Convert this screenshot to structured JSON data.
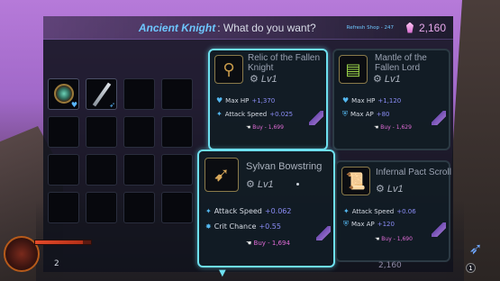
{
  "header": {
    "merchant": "Ancient Knight",
    "question": ": What do you want?",
    "refresh": "Refresh Shop - 247",
    "currency": "2,160"
  },
  "inventory": {
    "items": [
      "amulet-icon",
      "sword-icon"
    ],
    "empty_slots": 14
  },
  "shop": [
    {
      "name": "Relic of the Fallen Knight",
      "icon": "necklace-icon",
      "level": "Lv1",
      "stats": [
        {
          "label": "Max HP",
          "value": "+1,370"
        },
        {
          "label": "Attack Speed",
          "value": "+0.025"
        }
      ],
      "price": "Buy - 1,699"
    },
    {
      "name": "Mantle of the Fallen Lord",
      "icon": "mantle-icon",
      "level": "Lv1",
      "stats": [
        {
          "label": "Max HP",
          "value": "+1,120"
        },
        {
          "label": "Max AP",
          "value": "+80"
        }
      ],
      "price": "Buy - 1,629"
    },
    {
      "name": "Sylvan Bowstring",
      "icon": "bow-icon",
      "level": "Lv1",
      "stats": [
        {
          "label": "Attack Speed",
          "value": "+0.062"
        },
        {
          "label": "Crit Chance",
          "value": "+0.55"
        }
      ],
      "price": "Buy - 1,694"
    },
    {
      "name": "Infernal Pact Scroll",
      "icon": "scroll-icon",
      "level": "Lv1",
      "stats": [
        {
          "label": "Attack Speed",
          "value": "+0.06"
        },
        {
          "label": "Max AP",
          "value": "+120"
        }
      ],
      "price": "Buy - 1,690"
    }
  ],
  "hud": {
    "health_fraction": 0.85,
    "left_count": "2",
    "bottom_currency": "2,160",
    "right_count": "1"
  }
}
